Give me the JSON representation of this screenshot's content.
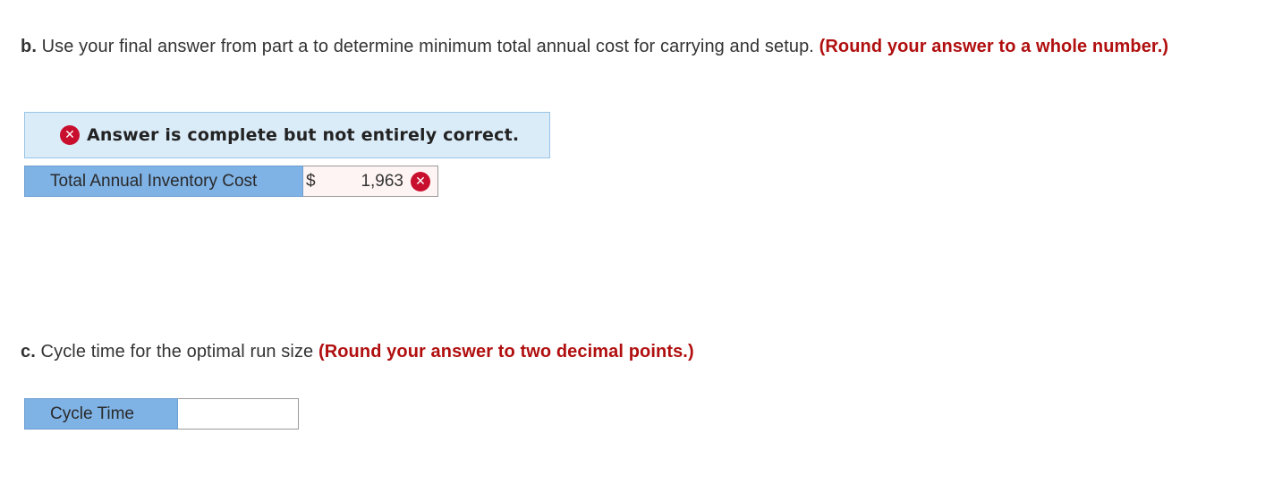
{
  "part_b": {
    "letter": "b.",
    "prompt": " Use your final answer from part a to determine minimum total annual cost for carrying and setup. ",
    "hint": "(Round your answer to a whole number.)"
  },
  "feedback": {
    "icon": "x-circle-icon",
    "icon_glyph": "✕",
    "text": "Answer is complete but not entirely correct.",
    "icon_color": "#c8102e"
  },
  "answer_b": {
    "label": "Total Annual Inventory Cost",
    "currency": "$",
    "value": "1,963",
    "status_icon": "x-circle-icon",
    "status_glyph": "✕"
  },
  "part_c": {
    "letter": "c.",
    "prompt": " Cycle time for the optimal run size ",
    "hint": "(Round your answer to two decimal points.)"
  },
  "answer_c": {
    "label": "Cycle Time",
    "value": ""
  },
  "colors": {
    "hint_red": "#b10f0f",
    "label_blue": "#7fb2e5",
    "banner_blue": "#dbecf9"
  }
}
